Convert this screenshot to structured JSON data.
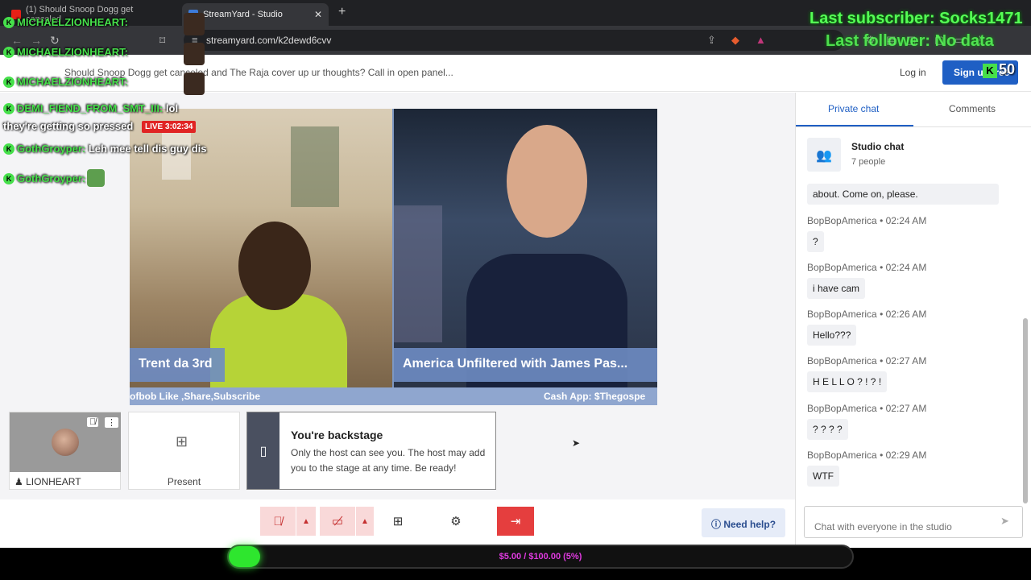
{
  "browser": {
    "tabs": [
      {
        "label": "(1) Should Snoop Dogg get canceled",
        "active": false
      },
      {
        "label": "StreamYard - Studio",
        "active": true
      }
    ],
    "url": "streamyard.com/k2dewd6cvv"
  },
  "header": {
    "title": "Should Snoop Dogg get canceled and The Raja cover up ur thoughts? Call in open panel...",
    "login_label": "Log in",
    "signup_label": "Sign up free"
  },
  "stage": {
    "live_badge": "LIVE 3:02:34",
    "participants": [
      {
        "name": "Trent da 3rd"
      },
      {
        "name": "America Unfiltered with James Pas..."
      }
    ],
    "ticker_left": "ofbob Like ,Share,Subscribe",
    "ticker_right": "Cash App: $Thegospe"
  },
  "backstage": {
    "self_name": "LIONHEART",
    "present_label": "Present",
    "title": "You're backstage",
    "text": "Only the host can see you. The host may add you to the stage at any time. Be ready!"
  },
  "controls": {
    "help_label": "Need help?"
  },
  "chat": {
    "tabs": [
      "Private chat",
      "Comments"
    ],
    "studio_title": "Studio chat",
    "studio_sub": "7 people",
    "messages": [
      {
        "author": "",
        "time": "",
        "text": "about. Come on, please."
      },
      {
        "author": "BopBopAmerica",
        "time": "02:24 AM",
        "text": "?"
      },
      {
        "author": "BopBopAmerica",
        "time": "02:24 AM",
        "text": "i have cam"
      },
      {
        "author": "BopBopAmerica",
        "time": "02:26 AM",
        "text": "Hello???"
      },
      {
        "author": "BopBopAmerica",
        "time": "02:27 AM",
        "text": "H E L L O ? ! ? !"
      },
      {
        "author": "BopBopAmerica",
        "time": "02:27 AM",
        "text": "? ? ? ?"
      },
      {
        "author": "BopBopAmerica",
        "time": "02:29 AM",
        "text": "WTF"
      }
    ],
    "meta_separator": "•",
    "input_placeholder": "Chat with everyone in the studio"
  },
  "overlay": {
    "chat_lines": [
      {
        "name": "MICHAELZIONHEART:",
        "text": ""
      },
      {
        "name": "MICHAELZIONHEART:",
        "text": ""
      },
      {
        "name": "MICHAELZIONHEART:",
        "text": ""
      },
      {
        "name": "DEMI_FIEND_FROM_SMT_III:",
        "text": " lol"
      },
      {
        "name": "",
        "text": "they're getting so pressed"
      },
      {
        "name": "GothGroyper:",
        "text": " Leh mee tell dis guy dis"
      },
      {
        "name": "GothGroyper:",
        "text": ""
      }
    ],
    "last_subscriber": "Last subscriber: Socks1471",
    "last_follower": "Last follower: No data",
    "viewer_count": "50",
    "goal_text": "$5.00 / $100.00 (5%)",
    "goal_fraction": 0.05
  }
}
